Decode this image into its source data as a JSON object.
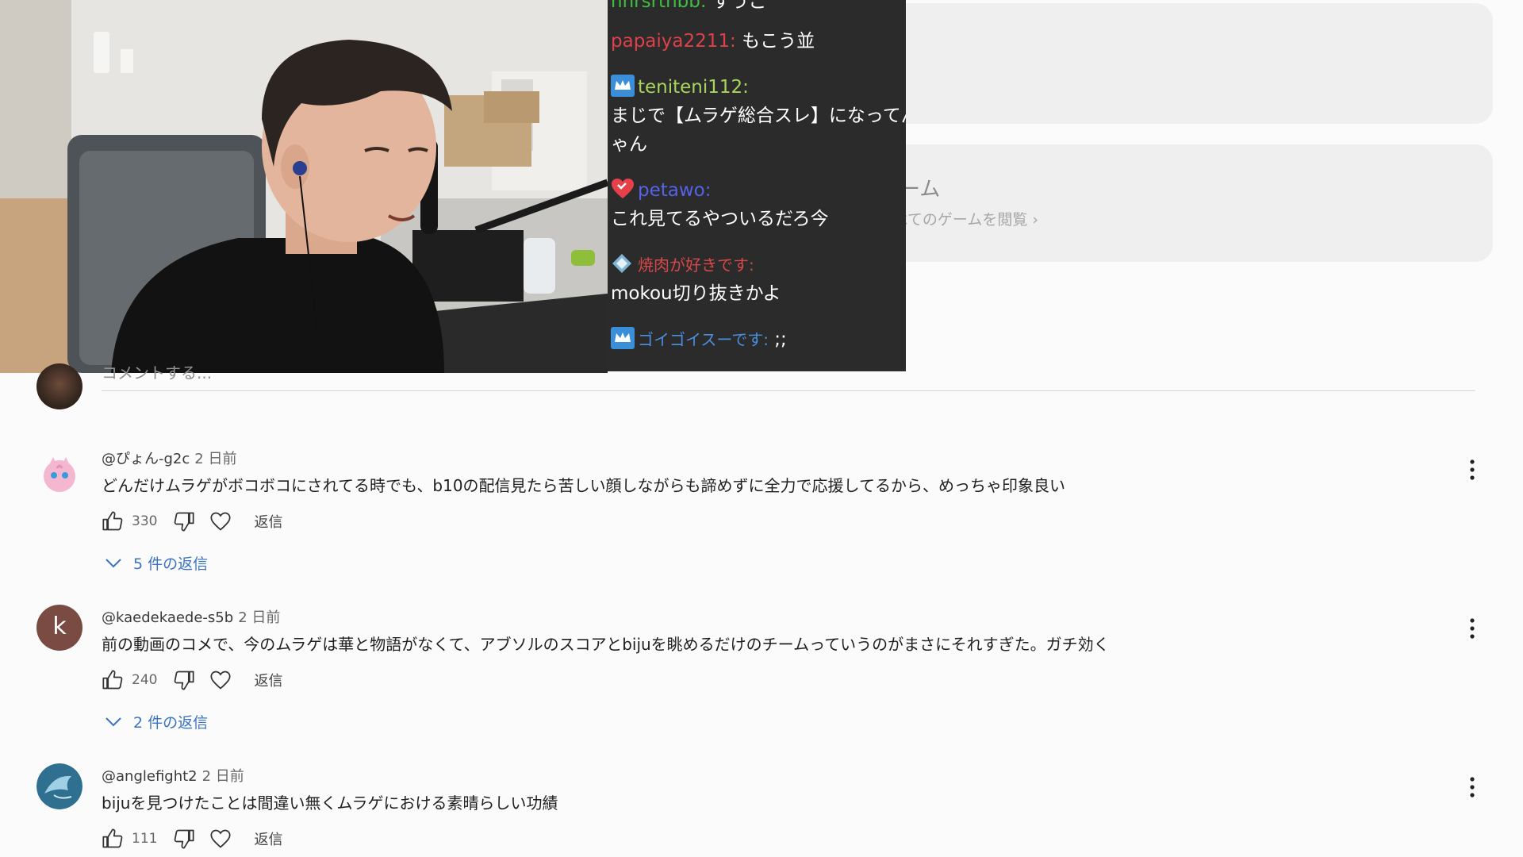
{
  "side_cards": {
    "game_title": "ゲーム",
    "game_browse": "すべてのゲームを閲覧 ›"
  },
  "chat": {
    "messages": [
      {
        "name": "hhrsrthbb:",
        "text": "すうご",
        "name_color": "#3fbf3f"
      },
      {
        "name": "papaiya2211:",
        "text": "もこう並",
        "name_color": "#e0404a"
      },
      {
        "name": "teniteni112:",
        "text": "まじで【ムラゲ総合スレ】になってんじ",
        "text2": "ゃん",
        "name_color": "#a6d65e"
      },
      {
        "name": "petawo:",
        "text": "これ見てるやついるだろ今",
        "name_color": "#5563e8"
      },
      {
        "name": "焼肉が好きです:",
        "text": "mokou切り抜きかよ",
        "name_color": "#d94848"
      },
      {
        "name": "ゴイゴイスーです:",
        "text": ";;",
        "name_color": "#4a8fe0"
      }
    ]
  },
  "add_comment": {
    "placeholder": "コメントする..."
  },
  "comments": [
    {
      "author": "@ぴょん-g2c",
      "time": "2 日前",
      "text": "どんだけムラゲがボコボコにされてる時でも、b10の配信見たら苦しい顔しながらも諦めずに全力で応援してるから、めっちゃ印象良い",
      "likes": "330",
      "reply_label": "返信",
      "replies": "5 件の返信"
    },
    {
      "author": "@kaedekaede-s5b",
      "time": "2 日前",
      "text": "前の動画のコメで、今のムラゲは華と物語がなくて、アブソルのスコアとbijuを眺めるだけのチームっていうのがまさにそれすぎた。ガチ効く",
      "likes": "240",
      "reply_label": "返信",
      "replies": "2 件の返信",
      "avatar_letter": "k"
    },
    {
      "author": "@anglefight2",
      "time": "2 日前",
      "text": "bijuを見つけたことは間違い無くムラゲにおける素晴らしい功績",
      "likes": "111",
      "reply_label": "返信"
    }
  ],
  "colors": {
    "accent_link": "#3a73c2",
    "chat_bg": "#2b2b2b",
    "page_bg": "#fbfbfb"
  }
}
